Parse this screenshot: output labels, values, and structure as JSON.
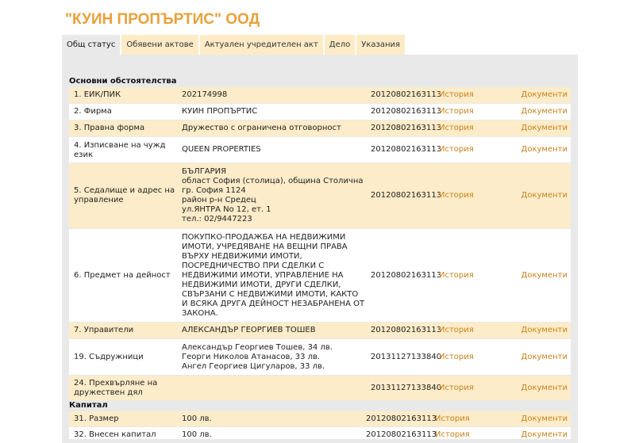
{
  "company_title": "\"КУИН ПРОПЪРТИС\" ООД",
  "tabs": [
    "Общ статус",
    "Обявени актове",
    "Актуален учредителен акт",
    "Дело",
    "Указания"
  ],
  "sections": {
    "main": "Основни обстоятелства",
    "capital": "Капитал"
  },
  "links": {
    "history": "История",
    "documents": "Документи"
  },
  "rows": [
    {
      "label": "1.  ЕИК/ПИК",
      "value": "202174998",
      "date": "20120802163113"
    },
    {
      "label": "2.  Фирма",
      "value": "КУИН ПРОПЪРТИС",
      "date": "20120802163113"
    },
    {
      "label": "3.  Правна форма",
      "value": "Дружество с ограничена отговорност",
      "date": "20120802163113"
    },
    {
      "label": "4.  Изписване на чужд език",
      "value": "QUEEN PROPERTIES",
      "date": "20120802163113"
    },
    {
      "label": "5.  Седалище и адрес на управление",
      "value_lines": [
        "БЪЛГАРИЯ",
        "област София (столица), община Столична",
        "гр. София 1124",
        "район р-н Средец",
        "ул.ЯНТРА No 12, ет. 1",
        "тел.: 02/9447223"
      ],
      "date": "20120802163113"
    },
    {
      "label": "6.  Предмет на дейност",
      "value": "ПОКУПКО-ПРОДАЖБА НА НЕДВИЖИМИ ИМОТИ, УЧРЕДЯВАНЕ НА ВЕЩНИ ПРАВА ВЪРХУ НЕДВИЖИМИ ИМОТИ, ПОСРЕДНИЧЕСТВО ПРИ СДЕЛКИ С НЕДВИЖИМИ ИМОТИ, УПРАВЛЕНИЕ НА НЕДВИЖИМИ ИМОТИ, ДРУГИ СДЕЛКИ, СВЪРЗАНИ С НЕДВИЖИМИ ИМОТИ, КАКТО И ВСЯКА ДРУГА ДЕЙНОСТ НЕЗАБРАНЕНА ОТ ЗАКОНА.",
      "date": "20120802163113"
    },
    {
      "label": "7.  Управители",
      "value": "АЛЕКСАНДЪР ГЕОРГИЕВ ТОШЕВ",
      "date": "20120802163113"
    },
    {
      "label": "19.  Съдружници",
      "value_lines": [
        "Александър Георгиев Тошев, 34 лв.",
        "Георги Николов Атанасов, 33 лв.",
        "Ангел Георгиев Цигуларов, 33 лв."
      ],
      "date": "20131127133840"
    },
    {
      "label": "24.  Прехвърляне на дружествен дял",
      "value": "",
      "date": "20131127133840"
    },
    {
      "label": "31.  Размер",
      "value": "100 лв.",
      "date": "20120802163113"
    },
    {
      "label": "32.  Внесен капитал",
      "value": "100 лв.",
      "date": "20120802163113"
    }
  ]
}
